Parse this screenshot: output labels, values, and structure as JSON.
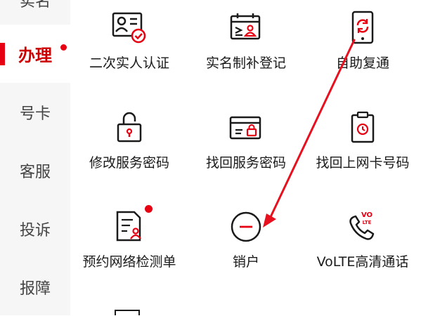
{
  "sidebar": {
    "items": [
      {
        "label": "实名",
        "active": false
      },
      {
        "label": "办理",
        "active": true
      },
      {
        "label": "号卡",
        "active": false
      },
      {
        "label": "客服",
        "active": false
      },
      {
        "label": "投诉",
        "active": false
      },
      {
        "label": "报障",
        "active": false
      }
    ]
  },
  "services": [
    {
      "label": "二次实人认证",
      "icon": "id-card-check-icon"
    },
    {
      "label": "实名制补登记",
      "icon": "calendar-person-icon"
    },
    {
      "label": "自助复通",
      "icon": "phone-refresh-icon"
    },
    {
      "label": "修改服务密码",
      "icon": "padlock-icon"
    },
    {
      "label": "找回服务密码",
      "icon": "card-lock-icon"
    },
    {
      "label": "找回上网卡号码",
      "icon": "clipboard-clock-icon"
    },
    {
      "label": "预约网络检测单",
      "icon": "document-person-icon"
    },
    {
      "label": "销户",
      "icon": "minus-circle-icon"
    },
    {
      "label": "VoLTE高清通话",
      "icon": "volte-phone-icon"
    }
  ],
  "colors": {
    "accent": "#e60012",
    "text": "#1a1a1a",
    "sidebar_bg": "#f6f6f6"
  }
}
